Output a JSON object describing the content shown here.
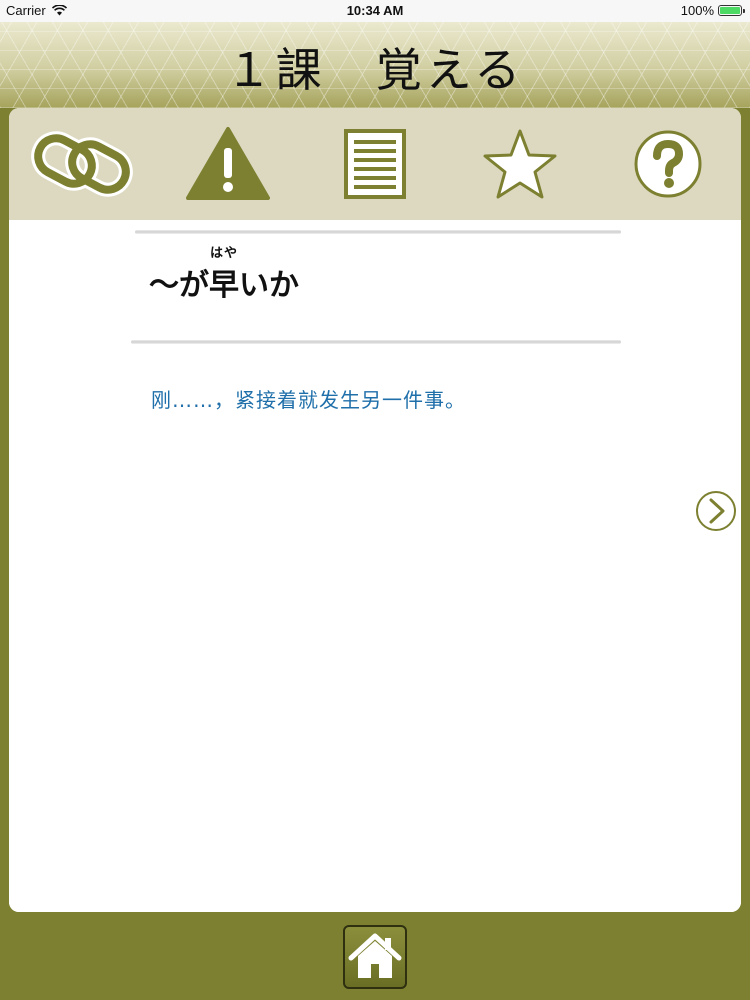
{
  "status_bar": {
    "carrier": "Carrier",
    "time": "10:34 AM",
    "battery_percent": "100%",
    "battery_level": 1.0
  },
  "header": {
    "title": "１課　覚える"
  },
  "toolbar": {
    "items": [
      {
        "icon": "link-icon"
      },
      {
        "icon": "warning-icon"
      },
      {
        "icon": "document-icon"
      },
      {
        "icon": "star-icon"
      },
      {
        "icon": "help-icon"
      }
    ]
  },
  "entry": {
    "prefix": "～が",
    "kanji": "早",
    "reading": "はや",
    "suffix": "いか",
    "meaning": "刚……，紧接着就发生另一件事。"
  },
  "navigation": {
    "next_icon": "chevron-right-icon",
    "home_icon": "home-icon"
  },
  "colors": {
    "accent": "#7c8030",
    "toolbar_bg": "#dcd9c0",
    "meaning_text": "#1f6faa"
  }
}
